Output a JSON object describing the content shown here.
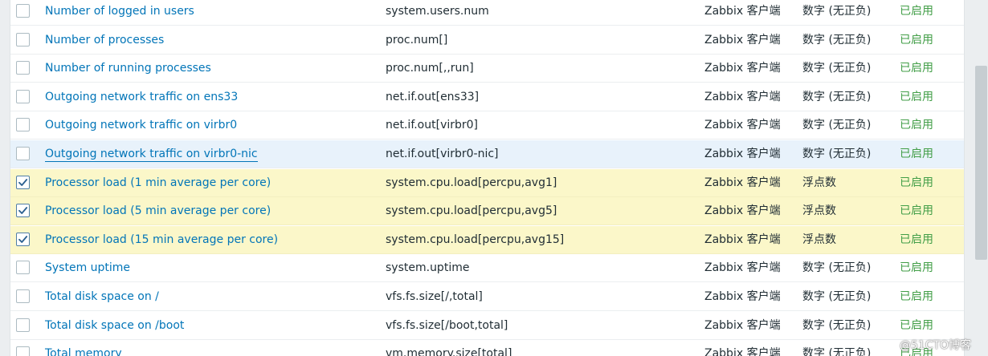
{
  "items": [
    {
      "name": "Number of logged in users",
      "key": "system.users.num",
      "type": "Zabbix 客户端",
      "info": "数字 (无正负)",
      "status": "已启用",
      "checked": false,
      "state": ""
    },
    {
      "name": "Number of processes",
      "key": "proc.num[]",
      "type": "Zabbix 客户端",
      "info": "数字 (无正负)",
      "status": "已启用",
      "checked": false,
      "state": ""
    },
    {
      "name": "Number of running processes",
      "key": "proc.num[,,run]",
      "type": "Zabbix 客户端",
      "info": "数字 (无正负)",
      "status": "已启用",
      "checked": false,
      "state": ""
    },
    {
      "name": "Outgoing network traffic on ens33",
      "key": "net.if.out[ens33]",
      "type": "Zabbix 客户端",
      "info": "数字 (无正负)",
      "status": "已启用",
      "checked": false,
      "state": ""
    },
    {
      "name": "Outgoing network traffic on virbr0",
      "key": "net.if.out[virbr0]",
      "type": "Zabbix 客户端",
      "info": "数字 (无正负)",
      "status": "已启用",
      "checked": false,
      "state": ""
    },
    {
      "name": "Outgoing network traffic on virbr0-nic",
      "key": "net.if.out[virbr0-nic]",
      "type": "Zabbix 客户端",
      "info": "数字 (无正负)",
      "status": "已启用",
      "checked": false,
      "state": "hovered"
    },
    {
      "name": "Processor load (1 min average per core)",
      "key": "system.cpu.load[percpu,avg1]",
      "type": "Zabbix 客户端",
      "info": "浮点数",
      "status": "已启用",
      "checked": true,
      "state": "selected"
    },
    {
      "name": "Processor load (5 min average per core)",
      "key": "system.cpu.load[percpu,avg5]",
      "type": "Zabbix 客户端",
      "info": "浮点数",
      "status": "已启用",
      "checked": true,
      "state": "selected"
    },
    {
      "name": "Processor load (15 min average per core)",
      "key": "system.cpu.load[percpu,avg15]",
      "type": "Zabbix 客户端",
      "info": "浮点数",
      "status": "已启用",
      "checked": true,
      "state": "selected"
    },
    {
      "name": "System uptime",
      "key": "system.uptime",
      "type": "Zabbix 客户端",
      "info": "数字 (无正负)",
      "status": "已启用",
      "checked": false,
      "state": ""
    },
    {
      "name": "Total disk space on /",
      "key": "vfs.fs.size[/,total]",
      "type": "Zabbix 客户端",
      "info": "数字 (无正负)",
      "status": "已启用",
      "checked": false,
      "state": ""
    },
    {
      "name": "Total disk space on /boot",
      "key": "vfs.fs.size[/boot,total]",
      "type": "Zabbix 客户端",
      "info": "数字 (无正负)",
      "status": "已启用",
      "checked": false,
      "state": ""
    },
    {
      "name": "Total memory",
      "key": "vm.memory.size[total]",
      "type": "Zabbix 客户端",
      "info": "数字 (无正负)",
      "status": "已启用",
      "checked": false,
      "state": ""
    }
  ],
  "watermark": "@51CTO博客",
  "colors": {
    "link": "#0275b8",
    "status_enabled": "#429e47",
    "selected_row": "#fbf7c9",
    "hover_row": "#e8f2fb"
  }
}
